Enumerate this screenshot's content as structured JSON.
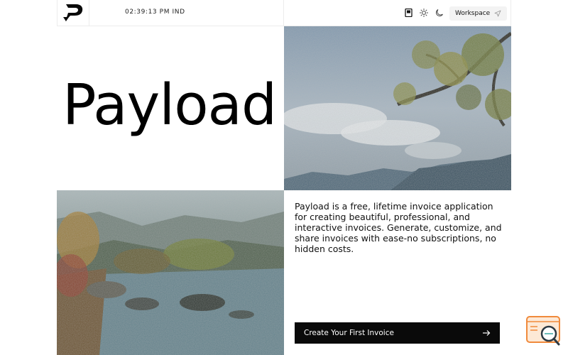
{
  "header": {
    "clock": "02:39:13 PM IND",
    "workspace_label": "Workspace",
    "icons": [
      "bookmark-icon",
      "sun-icon",
      "moon-icon",
      "send-icon"
    ]
  },
  "hero": {
    "title": "Payload",
    "description": "Payload is a free, lifetime invoice application for creating beautiful, professional, and interactive invoices. Generate, customize, and share invoices with ease-no subscriptions, no hidden costs.",
    "cta_label": "Create Your First Invoice"
  },
  "colors": {
    "accent": "#0a0a0a",
    "border": "#ececec",
    "widget": "#f08a3c"
  }
}
